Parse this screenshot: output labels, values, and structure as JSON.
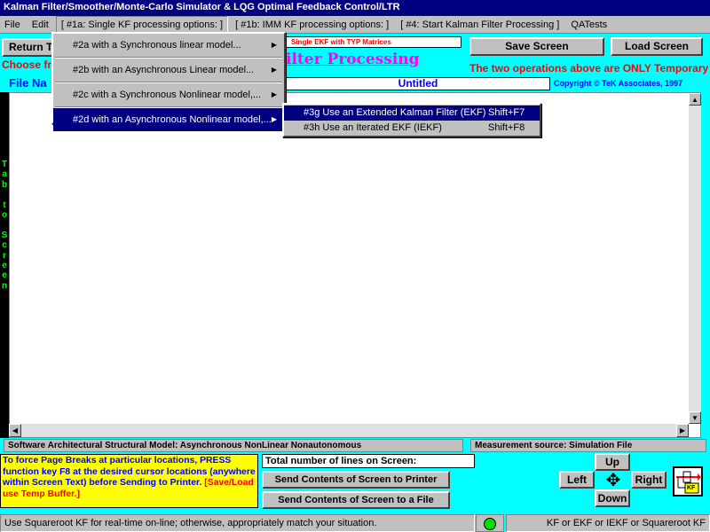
{
  "window": {
    "title": "Kalman Filter/Smoother/Monte-Carlo Simulator & LQG Optimal Feedback Control/LTR"
  },
  "menu": {
    "file": "File",
    "edit": "Edit",
    "single_kf": "[ #1a: Single KF processing options: ]",
    "imm_kf": "[ #1b: IMM KF processing options: ]",
    "start_kf": "[ #4: Start Kalman Filter Processing ]",
    "qatests": "QATests"
  },
  "dropdown": {
    "items": [
      {
        "label": "#2a with a Synchronous linear model..."
      },
      {
        "label": "#2b with an Asynchronous Linear model..."
      },
      {
        "label": "#2c with a Synchronous Nonlinear model,..."
      },
      {
        "label": "#2d with an Asynchronous Nonlinear model,..."
      }
    ],
    "arrow": "▶"
  },
  "submenu": {
    "items": [
      {
        "label": "#3g Use an Extended Kalman Filter (EKF)",
        "shortcut": "Shift+F7"
      },
      {
        "label": "#3h Use an Iterated EKF (IEKF)",
        "shortcut": "Shift+F8"
      }
    ]
  },
  "toolbar": {
    "return_label": "Return T",
    "ekf_label": "Single EKF with TYP Matrices",
    "save_screen": "Save Screen",
    "load_screen": "Load Screen"
  },
  "header": {
    "choose_text": "Choose fro",
    "filter_processing": "ilter Processing",
    "temporary_note": "The two operations above are ONLY Temporary",
    "file_name_label": "File Na",
    "file_name_value": "Untitled",
    "copyright": "Copyright © TeK Associates, 1997"
  },
  "side_label": {
    "text": "Tab to Screen",
    "chars": [
      "T",
      "a",
      "b",
      "",
      "t",
      "o",
      "",
      "S",
      "c",
      "r",
      "e",
      "e",
      "n"
    ]
  },
  "scroll": {
    "up": "▲",
    "down": "▼",
    "left": "◀",
    "right": "▶"
  },
  "status": {
    "model": "Software Architectural Structural Model:  Asynchronous NonLinear Nonautonomous",
    "measurement": "Measurement source:  Simulation File"
  },
  "info": {
    "text": "To force  Page Breaks at particular locations, PRESS function key F8 at the desired cursor locations (anywhere within Screen Text) before Sending to Printer.",
    "highlight": "[Save/Load use Temp Buffer.]"
  },
  "lines": {
    "label": "Total number of lines on Screen:"
  },
  "buttons": {
    "send_printer": "Send  Contents of Screen to Printer",
    "send_file": "Send Contents of Screen to a File"
  },
  "nav": {
    "up": "Up",
    "down": "Down",
    "left": "Left",
    "right": "Right",
    "move_icon": "✥"
  },
  "kf_icon": {
    "label": "KF"
  },
  "footer": {
    "left": "Use Squareroot KF for real-time on-line; otherwise, appropriately match your situation.",
    "right": "KF or EKF or IEKF or Squareroot KF"
  },
  "colors": {
    "background": "#00FFFF",
    "title_bar": "#000080",
    "red_text": "#FF0000",
    "magenta_text": "#FF00FF",
    "blue_text": "#0000FF",
    "green_text": "#00C000",
    "highlight_box": "#FFFF00",
    "status_light": "#00E000"
  }
}
